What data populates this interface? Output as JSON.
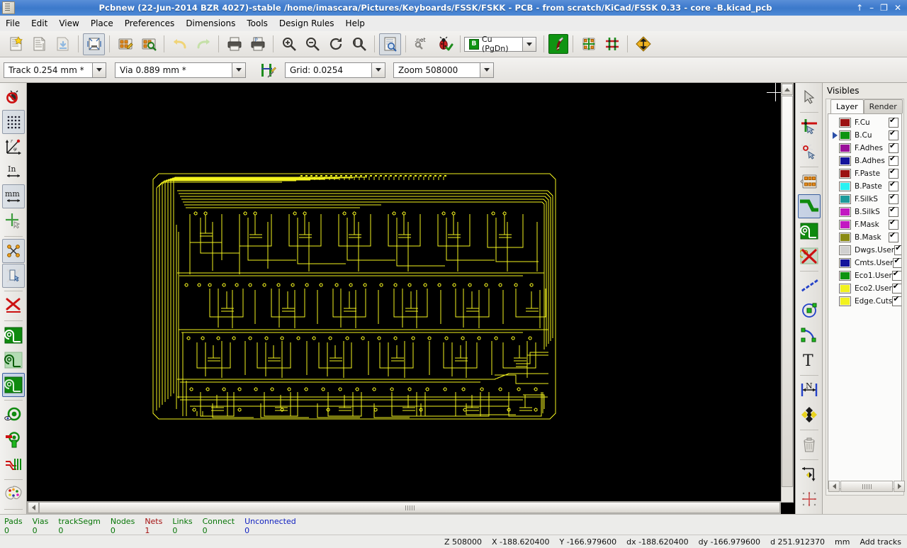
{
  "window": {
    "title": "Pcbnew (22-Jun-2014 BZR 4027)-stable /home/imascara/Pictures/Keyboards/FSSK/FSKK - PCB - from scratch/KiCad/FSSK 0.33 - core -B.kicad_pcb",
    "buttons": {
      "rollup": "↑",
      "minimize": "–",
      "maximize": "❐",
      "close": "✕"
    },
    "app_icon": "pcbnew-icon"
  },
  "menu": [
    {
      "label": "File"
    },
    {
      "label": "Edit"
    },
    {
      "label": "View"
    },
    {
      "label": "Place"
    },
    {
      "label": "Preferences"
    },
    {
      "label": "Dimensions"
    },
    {
      "label": "Tools"
    },
    {
      "label": "Design Rules"
    },
    {
      "label": "Help"
    }
  ],
  "toolbar_main": [
    {
      "name": "new-board-button",
      "icon": "new-board-icon"
    },
    {
      "name": "open-board-button",
      "icon": "open-board-icon"
    },
    {
      "name": "save-board-button",
      "icon": "save-board-icon"
    },
    {
      "name": "page-settings-button",
      "icon": "page-settings-icon"
    },
    {
      "name": "open-module-editor-button",
      "icon": "module-editor-icon"
    },
    {
      "name": "open-module-viewer-button",
      "icon": "module-viewer-icon"
    },
    {
      "name": "undo-button",
      "icon": "undo-icon"
    },
    {
      "name": "redo-button",
      "icon": "redo-icon"
    },
    {
      "name": "print-button",
      "icon": "print-icon"
    },
    {
      "name": "plot-button",
      "icon": "plot-icon"
    },
    {
      "name": "zoom-in-button",
      "icon": "zoom-in-icon"
    },
    {
      "name": "zoom-out-button",
      "icon": "zoom-out-icon"
    },
    {
      "name": "zoom-redraw-button",
      "icon": "refresh-icon"
    },
    {
      "name": "zoom-fit-button",
      "icon": "zoom-fit-icon"
    },
    {
      "name": "find-button",
      "icon": "find-icon"
    },
    {
      "name": "netlist-button",
      "icon": "netlist-icon"
    },
    {
      "name": "drc-button",
      "icon": "drc-bug-icon"
    }
  ],
  "layer_selector": {
    "prefix": "B",
    "label": "Cu (PgDn)"
  },
  "toolbar_extras": [
    {
      "name": "mode-track-button",
      "icon": "track-mode-icon"
    },
    {
      "name": "mode-module-button",
      "icon": "module-mode-icon"
    },
    {
      "name": "show-ratsnest-button",
      "icon": "ratsnest-icon"
    },
    {
      "name": "highcontrast-button",
      "icon": "high-contrast-icon"
    }
  ],
  "toolbar_aux": {
    "track_width": {
      "label": "Track 0.254 mm *",
      "name": "track-width-combo"
    },
    "via_size": {
      "label": "Via 0.889 mm *",
      "name": "via-size-combo"
    },
    "netclass_button": {
      "name": "netclass-button",
      "icon": "netclass-icon"
    },
    "grid": {
      "label": "Grid: 0.0254",
      "name": "grid-combo"
    },
    "zoom": {
      "label": "Zoom 508000",
      "name": "zoom-combo"
    }
  },
  "left_toolbar": [
    {
      "name": "drc-off-toggle",
      "icon": "drc-off-icon",
      "state": "off"
    },
    {
      "name": "grid-toggle",
      "icon": "grid-dots-icon",
      "state": "on"
    },
    {
      "name": "polar-coords-toggle",
      "icon": "polar-coords-icon",
      "state": "off"
    },
    {
      "name": "units-inch-toggle",
      "icon": "units-inch-icon",
      "state": "off"
    },
    {
      "name": "units-mm-toggle",
      "icon": "units-mm-icon",
      "state": "on"
    },
    {
      "name": "cursor-shape-toggle",
      "icon": "full-crosshair-icon",
      "state": "off"
    },
    {
      "name": "show-ratsnest-toggle",
      "icon": "ratsnest-general-icon",
      "state": "on"
    },
    {
      "name": "show-module-ratsnest-toggle",
      "icon": "ratsnest-module-icon",
      "state": "on"
    },
    {
      "name": "auto-delete-tracks-toggle",
      "icon": "auto-delete-track-icon",
      "state": "off"
    },
    {
      "name": "show-zones-toggle",
      "icon": "zone-filled-icon",
      "state": "on"
    },
    {
      "name": "show-zones-outline-only-toggle",
      "icon": "zone-outline-icon",
      "state": "off"
    },
    {
      "name": "show-zones-disable-toggle",
      "icon": "zone-disabled-icon",
      "state": "on"
    },
    {
      "name": "pads-sketch-toggle",
      "icon": "pad-sketch-icon",
      "state": "off"
    },
    {
      "name": "vias-sketch-toggle",
      "icon": "via-sketch-icon",
      "state": "off"
    },
    {
      "name": "tracks-sketch-toggle",
      "icon": "track-sketch-icon",
      "state": "off"
    },
    {
      "name": "contrast-mode-toggle",
      "icon": "palette-icon",
      "state": "off"
    }
  ],
  "right_toolbar": [
    {
      "name": "select-tool",
      "icon": "cursor-arrow-icon",
      "state": "off"
    },
    {
      "name": "highlight-net-tool",
      "icon": "highlight-net-icon",
      "state": "off"
    },
    {
      "name": "local-ratsnest-tool",
      "icon": "local-ratsnest-icon",
      "state": "off"
    },
    {
      "name": "add-module-tool",
      "icon": "add-module-icon",
      "state": "off"
    },
    {
      "name": "add-track-tool",
      "icon": "add-track-icon",
      "state": "on"
    },
    {
      "name": "add-zone-tool",
      "icon": "add-zone-icon",
      "state": "off"
    },
    {
      "name": "delete-zone-tool",
      "icon": "delete-zone-icon",
      "state": "off"
    },
    {
      "name": "add-keepout-tool",
      "icon": "keepout-dashed-icon",
      "state": "off"
    },
    {
      "name": "add-circle-tool",
      "icon": "add-circle-icon",
      "state": "off"
    },
    {
      "name": "add-arc-tool",
      "icon": "add-arc-icon",
      "state": "off"
    },
    {
      "name": "add-text-tool",
      "icon": "add-text-icon",
      "state": "off"
    },
    {
      "name": "add-dimension-tool",
      "icon": "add-dimension-icon",
      "state": "off"
    },
    {
      "name": "add-target-tool",
      "icon": "add-target-icon",
      "state": "off"
    },
    {
      "name": "delete-tool",
      "icon": "trash-icon",
      "state": "off"
    },
    {
      "name": "set-origin-tool",
      "icon": "set-origin-icon",
      "state": "off"
    },
    {
      "name": "set-grid-origin-tool",
      "icon": "grid-origin-icon",
      "state": "off"
    }
  ],
  "visibles": {
    "title": "Visibles",
    "tabs": [
      {
        "label": "Layer",
        "selected": true
      },
      {
        "label": "Render",
        "selected": false
      }
    ],
    "layers": [
      {
        "name": "F.Cu",
        "color": "#9c1212",
        "visible": true,
        "active": false
      },
      {
        "name": "B.Cu",
        "color": "#0f9412",
        "visible": true,
        "active": true
      },
      {
        "name": "F.Adhes",
        "color": "#9a0f9a",
        "visible": true,
        "active": false
      },
      {
        "name": "B.Adhes",
        "color": "#14149c",
        "visible": true,
        "active": false
      },
      {
        "name": "F.Paste",
        "color": "#9c1212",
        "visible": true,
        "active": false
      },
      {
        "name": "B.Paste",
        "color": "#29f2f2",
        "visible": true,
        "active": false
      },
      {
        "name": "F.SilkS",
        "color": "#1d9c9c",
        "visible": true,
        "active": false
      },
      {
        "name": "B.SilkS",
        "color": "#c217c2",
        "visible": true,
        "active": false
      },
      {
        "name": "F.Mask",
        "color": "#c217c2",
        "visible": true,
        "active": false
      },
      {
        "name": "B.Mask",
        "color": "#8a8a13",
        "visible": true,
        "active": false
      },
      {
        "name": "Dwgs.User",
        "color": "#d0d0d0",
        "visible": true,
        "active": false
      },
      {
        "name": "Cmts.User",
        "color": "#14149c",
        "visible": true,
        "active": false
      },
      {
        "name": "Eco1.User",
        "color": "#0f9412",
        "visible": true,
        "active": false
      },
      {
        "name": "Eco2.User",
        "color": "#f2f21e",
        "visible": true,
        "active": false
      },
      {
        "name": "Edge.Cuts",
        "color": "#f2f21e",
        "visible": true,
        "active": false
      }
    ]
  },
  "status": {
    "counters": [
      {
        "label": "Pads",
        "value": "0",
        "color": "green"
      },
      {
        "label": "Vias",
        "value": "0",
        "color": "green"
      },
      {
        "label": "trackSegm",
        "value": "0",
        "color": "green"
      },
      {
        "label": "Nodes",
        "value": "0",
        "color": "green"
      },
      {
        "label": "Nets",
        "value": "1",
        "color": "red"
      },
      {
        "label": "Links",
        "value": "0",
        "color": "green"
      },
      {
        "label": "Connect",
        "value": "0",
        "color": "green"
      },
      {
        "label": "Unconnected",
        "value": "0",
        "color": "blue"
      }
    ],
    "fields": [
      {
        "name": "zoom-readout",
        "text": "Z 508000"
      },
      {
        "name": "x-readout",
        "text": "X -188.620400"
      },
      {
        "name": "y-readout",
        "text": "Y -166.979600"
      },
      {
        "name": "dx-readout",
        "text": "dx -188.620400"
      },
      {
        "name": "dy-readout",
        "text": "dy -166.979600"
      },
      {
        "name": "dist-readout",
        "text": "d 251.912370"
      },
      {
        "name": "units-readout",
        "text": "mm"
      },
      {
        "name": "tool-readout",
        "text": "Add tracks"
      }
    ]
  },
  "canvas": {
    "background": "#000000",
    "trace_color": "#f2f21e",
    "board_outline_color": "#f2f21e",
    "description": "Back-copper keyboard PCB layout with rounded-rect board outline and dense yellow traces"
  }
}
